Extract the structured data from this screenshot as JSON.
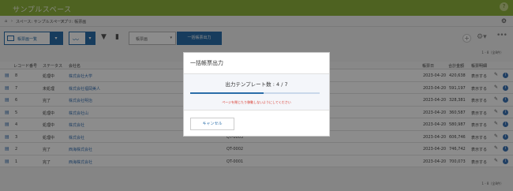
{
  "header": {
    "title": "サンプルスペース",
    "help_icon": "?"
  },
  "breadcrumb": {
    "items": [
      "スペース: サンプルスペース",
      "アプリ: 帳票画"
    ]
  },
  "toolbar": {
    "view_label": "帳票画一覧",
    "print_select": "帳票画",
    "bulk_button": "一括帳票出力",
    "pager_top": "1 - 8（全8件）"
  },
  "table": {
    "columns": [
      "レコード番号",
      "ステータス",
      "会社名",
      "帳票日",
      "合計金額",
      "帳票明細"
    ],
    "rows": [
      {
        "id": "8",
        "status": "処理中",
        "company": "株式会社大学",
        "quote": "",
        "date": "2023-04-20",
        "amount": "420,638",
        "detail": "表示する"
      },
      {
        "id": "7",
        "status": "未処理",
        "company": "株式会社福岡美人",
        "quote": "",
        "date": "2023-04-20",
        "amount": "591,197",
        "detail": "表示する"
      },
      {
        "id": "6",
        "status": "完了",
        "company": "株式会社明治",
        "quote": "",
        "date": "2023-04-20",
        "amount": "328,381",
        "detail": "表示する"
      },
      {
        "id": "5",
        "status": "処理中",
        "company": "株式会社山",
        "quote": "",
        "date": "2023-04-20",
        "amount": "360,587",
        "detail": "表示する"
      },
      {
        "id": "4",
        "status": "処理中",
        "company": "株式会社",
        "quote": "",
        "date": "2023-04-20",
        "amount": "580,987",
        "detail": "表示する"
      },
      {
        "id": "3",
        "status": "処理中",
        "company": "株式会社",
        "quote": "QT-0003",
        "date": "2023-04-20",
        "amount": "606,746",
        "detail": "表示する"
      },
      {
        "id": "2",
        "status": "完了",
        "company": "西海株式会社",
        "quote": "QT-0002",
        "date": "2023-04-20",
        "amount": "746,742",
        "detail": "表示する"
      },
      {
        "id": "1",
        "status": "完了",
        "company": "西海株式会社",
        "quote": "QT-0001",
        "date": "2023-04-20",
        "amount": "700,073",
        "detail": "表示する"
      }
    ],
    "pager_bottom": "1 - 8（全8件）"
  },
  "modal": {
    "title": "一括帳票出力",
    "count_text": "出力テンプレート数 : 4 / 7",
    "progress": 0.57,
    "warning": "ページを閉じたり移動しないようにしてください",
    "cancel_label": "キャンセル"
  },
  "colors": {
    "header_green": "#8fb23c",
    "accent_blue": "#2b6ea9",
    "warning_red": "#d8352a"
  }
}
